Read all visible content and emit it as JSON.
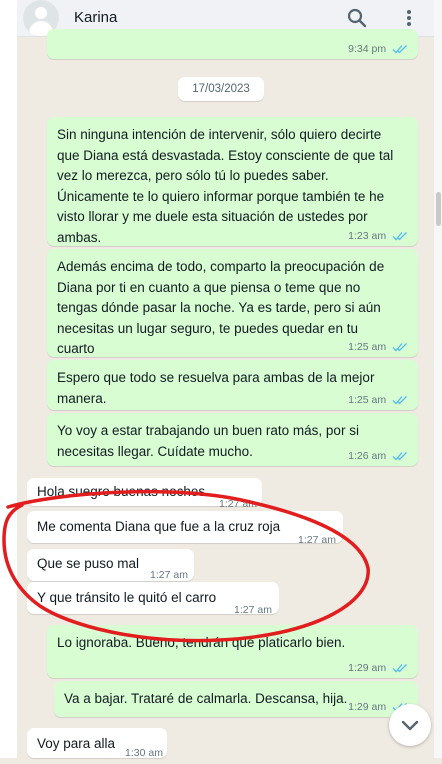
{
  "header": {
    "contact_name": "Karina",
    "search_icon": "search-icon",
    "menu_icon": "more-vertical-icon"
  },
  "colors": {
    "outgoing_bubble": "#d9fdd3",
    "incoming_bubble": "#ffffff",
    "read_ticks": "#53bdeb",
    "annotation_circle": "#e11d1d"
  },
  "messages": {
    "top_time": "9:34 pm",
    "date_chip": "17/03/2023",
    "m1": {
      "lines": [
        "Sin ninguna intención de intervenir, sólo quiero decirte",
        "que Diana está desvastada. Estoy consciente de que tal",
        "vez lo merezca, pero sólo tú lo puedes saber.",
        "Únicamente te lo quiero informar porque también te he",
        "visto llorar y me duele esta situación de ustedes por",
        "ambas."
      ],
      "time": "1:23 am"
    },
    "m2": {
      "lines": [
        "Además encima de todo, comparto la preocupación de",
        "Diana por ti en cuanto a que piensa o teme que no",
        "tengas dónde pasar la noche. Ya es tarde, pero si aún",
        "necesitas un lugar seguro, te puedes quedar en tu",
        "cuarto"
      ],
      "time": "1:25 am"
    },
    "m3": {
      "lines": [
        "Espero que todo se resuelva para ambas de la mejor",
        "manera."
      ],
      "time": "1:25 am"
    },
    "m4": {
      "lines": [
        "Yo voy a estar trabajando un buen rato más, por si",
        "necesitas llegar. Cuídate mucho."
      ],
      "time": "1:26 am"
    },
    "i1": {
      "text": "Hola suegro buenas noches",
      "time": "1:27 am"
    },
    "i2": {
      "text": "Me comenta Diana que fue a la cruz roja",
      "time": "1:27 am"
    },
    "i3": {
      "text": "Que se puso mal",
      "time": "1:27 am"
    },
    "i4": {
      "text": "Y que tránsito le quitó el carro",
      "time": "1:27 am"
    },
    "m5": {
      "text": "Lo ignoraba. Bueno, tendrán que platicarlo bien.",
      "time": "1:29 am"
    },
    "m6": {
      "text": "Va a bajar. Trataré de calmarla. Descansa, hija.",
      "time": "1:29 am"
    },
    "i5": {
      "text": "Voy para alla",
      "time": "1:30 am"
    }
  },
  "scroll_down_icon": "chevron-down-icon"
}
